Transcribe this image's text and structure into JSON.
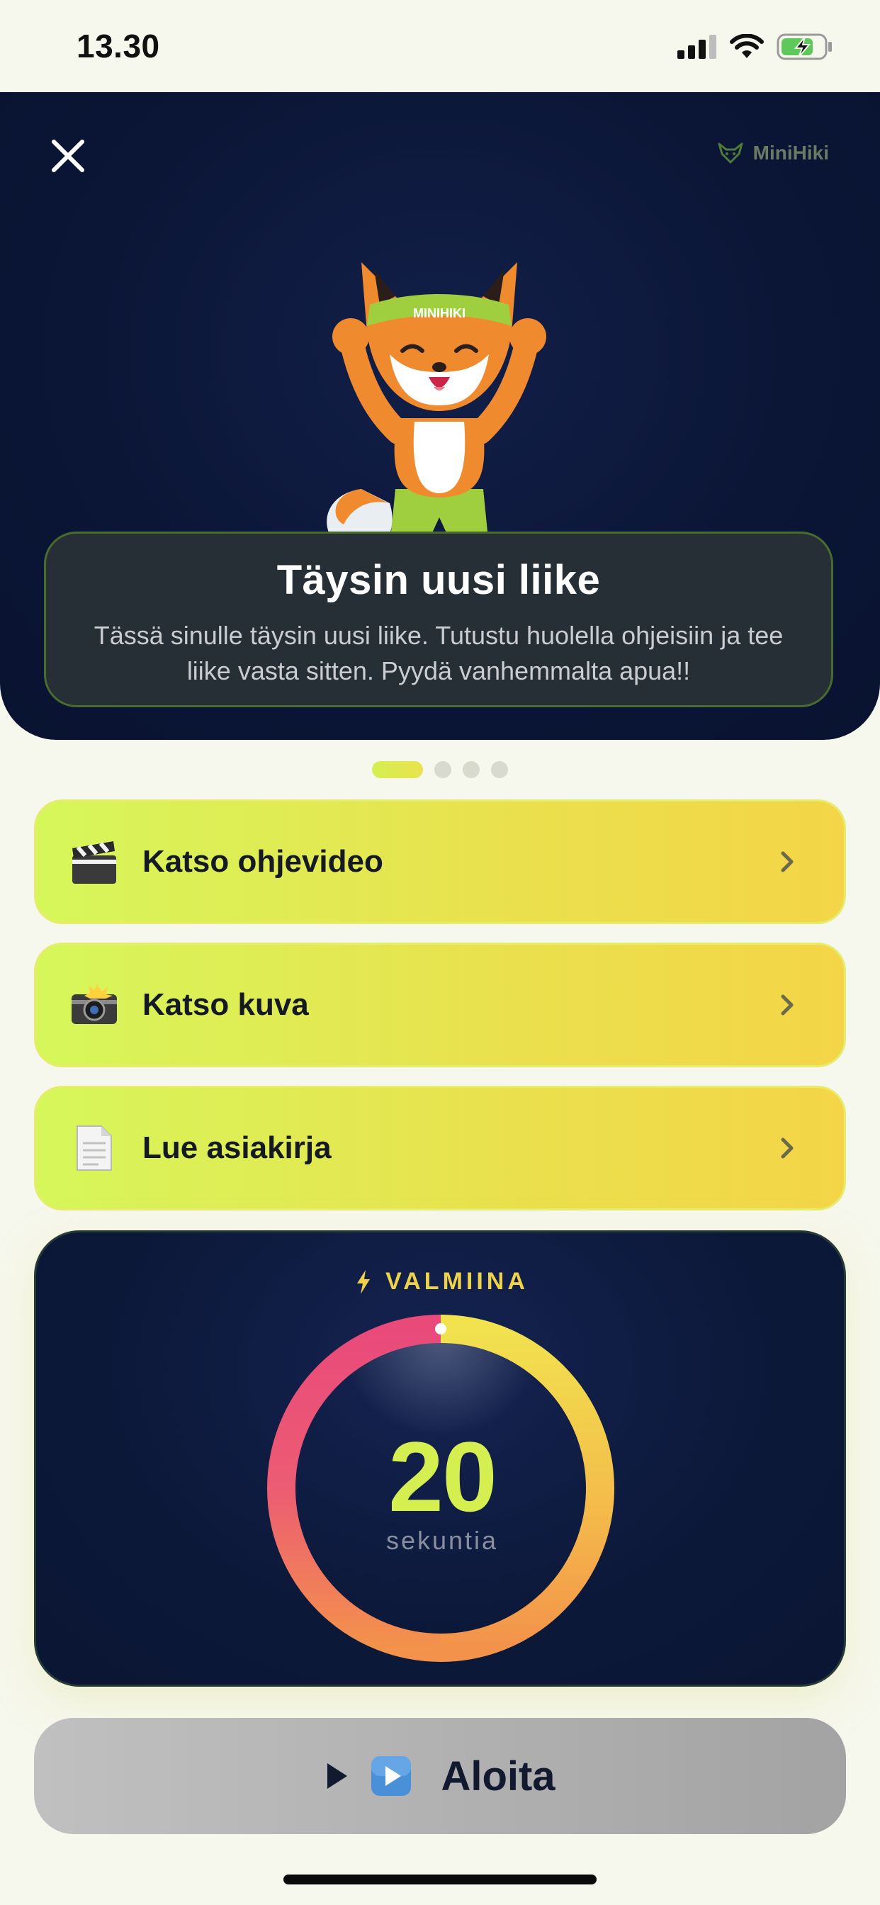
{
  "status_bar": {
    "time": "13.30",
    "icons": [
      "signal-icon",
      "wifi-icon",
      "battery-charging-icon"
    ]
  },
  "header": {
    "close_icon": "close-icon",
    "brand": "MiniHiki",
    "brand_icon": "fox-logo-icon"
  },
  "mascot": {
    "headband_text": "MINIHIKI"
  },
  "info_card": {
    "title": "Täysin uusi liike",
    "text": "Tässä sinulle täysin uusi liike. Tutustu huolella ohjeisiin ja tee liike vasta sitten. Pyydä vanhemmalta apua!!"
  },
  "pager": {
    "count": 4,
    "active_index": 0
  },
  "actions": [
    {
      "label": "Katso ohjevideo",
      "icon": "clapper-board-icon"
    },
    {
      "label": "Katso kuva",
      "icon": "camera-flash-icon"
    },
    {
      "label": "Lue asiakirja",
      "icon": "document-icon"
    }
  ],
  "timer": {
    "status": "VALMIINA",
    "status_icon": "lightning-icon",
    "value": "20",
    "unit": "sekuntia",
    "progress": 1.0
  },
  "start_button": {
    "label": "Aloita",
    "icons": [
      "play-icon",
      "play-button-emoji-icon"
    ]
  },
  "colors": {
    "accent_green": "#d5ee50",
    "accent_yellow": "#eed24a",
    "ring_pink": "#ea4a7c",
    "ring_orange": "#f39a4a",
    "hero_bg": "#0b1637"
  }
}
